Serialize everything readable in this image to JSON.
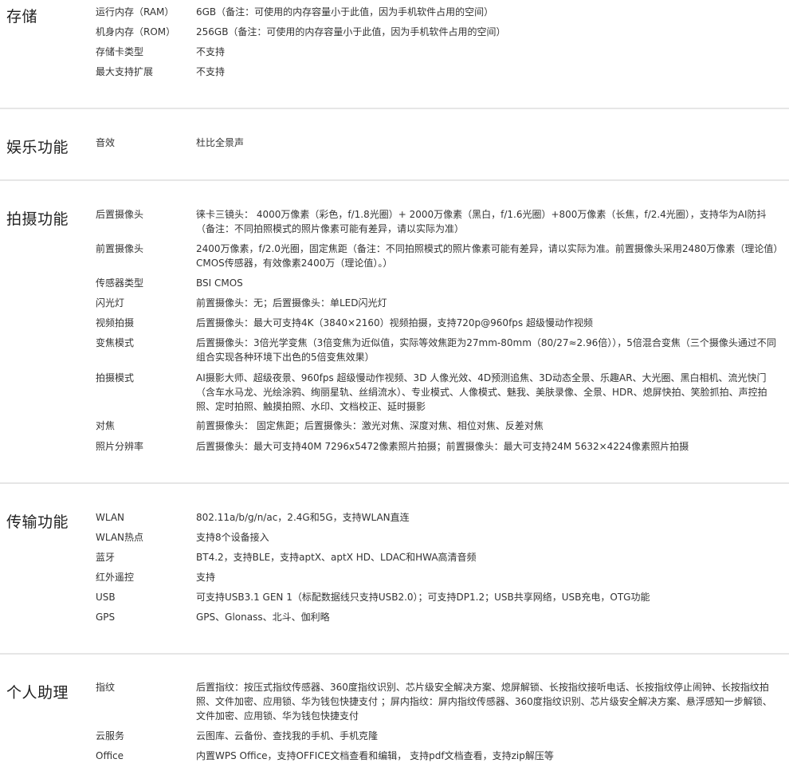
{
  "sections": [
    {
      "title": "存储",
      "rows": [
        {
          "label": "运行内存（RAM）",
          "value": "6GB（备注：可使用的内存容量小于此值，因为手机软件占用的空间）"
        },
        {
          "label": "机身内存（ROM）",
          "value": "256GB（备注：可使用的内存容量小于此值，因为手机软件占用的空间）"
        },
        {
          "label": "存储卡类型",
          "value": "不支持"
        },
        {
          "label": "最大支持扩展",
          "value": "不支持"
        }
      ]
    },
    {
      "title": "娱乐功能",
      "rows": [
        {
          "label": "音效",
          "value": "杜比全景声"
        }
      ]
    },
    {
      "title": "拍摄功能",
      "rows": [
        {
          "label": "后置摄像头",
          "value": "徕卡三镜头： 4000万像素（彩色，f/1.8光圈）+ 2000万像素（黑白，f/1.6光圈）+800万像素（长焦，f/2.4光圈），支持华为AI防抖 （备注：不同拍照模式的照片像素可能有差异，请以实际为准）"
        },
        {
          "label": "前置摄像头",
          "value": "2400万像素，f/2.0光圈，固定焦距（备注：不同拍照模式的照片像素可能有差异，请以实际为准。前置摄像头采用2480万像素（理论值）CMOS传感器，有效像素2400万（理论值）。）"
        },
        {
          "label": "传感器类型",
          "value": "BSI CMOS"
        },
        {
          "label": "闪光灯",
          "value": "前置摄像头：无；后置摄像头：单LED闪光灯"
        },
        {
          "label": "视频拍摄",
          "value": "后置摄像头：最大可支持4K（3840×2160）视频拍摄，支持720p@960fps 超级慢动作视频"
        },
        {
          "label": "变焦模式",
          "value": "后置摄像头：3倍光学变焦（3倍变焦为近似值，实际等效焦距为27mm-80mm（80/27≈2.96倍）），5倍混合变焦（三个摄像头通过不同组合实现各种环境下出色的5倍变焦效果）"
        },
        {
          "label": "拍摄模式",
          "value": "AI摄影大师、超级夜景、960fps 超级慢动作视频、3D 人像光效、4D预测追焦、3D动态全景、乐趣AR、大光圈、黑白相机、流光快门（含车水马龙、光绘涂鸦、绚丽星轨、丝绢流水）、专业模式、人像模式、魅我、美肤录像、全景、HDR、熄屏快拍、笑脸抓拍、声控拍照、定时拍照、触摸拍照、水印、文档校正、延时摄影"
        },
        {
          "label": "对焦",
          "value": "前置摄像头： 固定焦距；后置摄像头：激光对焦、深度对焦、相位对焦、反差对焦"
        },
        {
          "label": "照片分辨率",
          "value": "后置摄像头：最大可支持40M 7296x5472像素照片拍摄；前置摄像头：最大可支持24M 5632×4224像素照片拍摄"
        }
      ]
    },
    {
      "title": "传输功能",
      "rows": [
        {
          "label": "WLAN",
          "value": "802.11a/b/g/n/ac，2.4G和5G，支持WLAN直连"
        },
        {
          "label": "WLAN热点",
          "value": "支持8个设备接入"
        },
        {
          "label": "蓝牙",
          "value": "BT4.2，支持BLE，支持aptX、aptX HD、LDAC和HWA高清音频"
        },
        {
          "label": "红外遥控",
          "value": "支持"
        },
        {
          "label": "USB",
          "value": "可支持USB3.1 GEN 1（标配数据线只支持USB2.0）；可支持DP1.2；USB共享网络，USB充电，OTG功能"
        },
        {
          "label": "GPS",
          "value": "GPS、Glonass、北斗、伽利略"
        }
      ]
    },
    {
      "title": "个人助理",
      "rows": [
        {
          "label": "指纹",
          "value": "后置指纹：按压式指纹传感器、360度指纹识别、芯片级安全解决方案、熄屏解锁、长按指纹接听电话、长按指纹停止闹钟、长按指纹拍照、文件加密、应用锁、华为钱包快捷支付 ；屏内指纹：屏内指纹传感器、360度指纹识别、芯片级安全解决方案、悬浮感知一步解锁、文件加密、应用锁、华为钱包快捷支付"
        },
        {
          "label": "云服务",
          "value": "云图库、云备份、查找我的手机、手机克隆"
        },
        {
          "label": "Office",
          "value": "内置WPS Office，支持OFFICE文档查看和编辑， 支持pdf文档查看，支持zip解压等"
        }
      ]
    }
  ]
}
